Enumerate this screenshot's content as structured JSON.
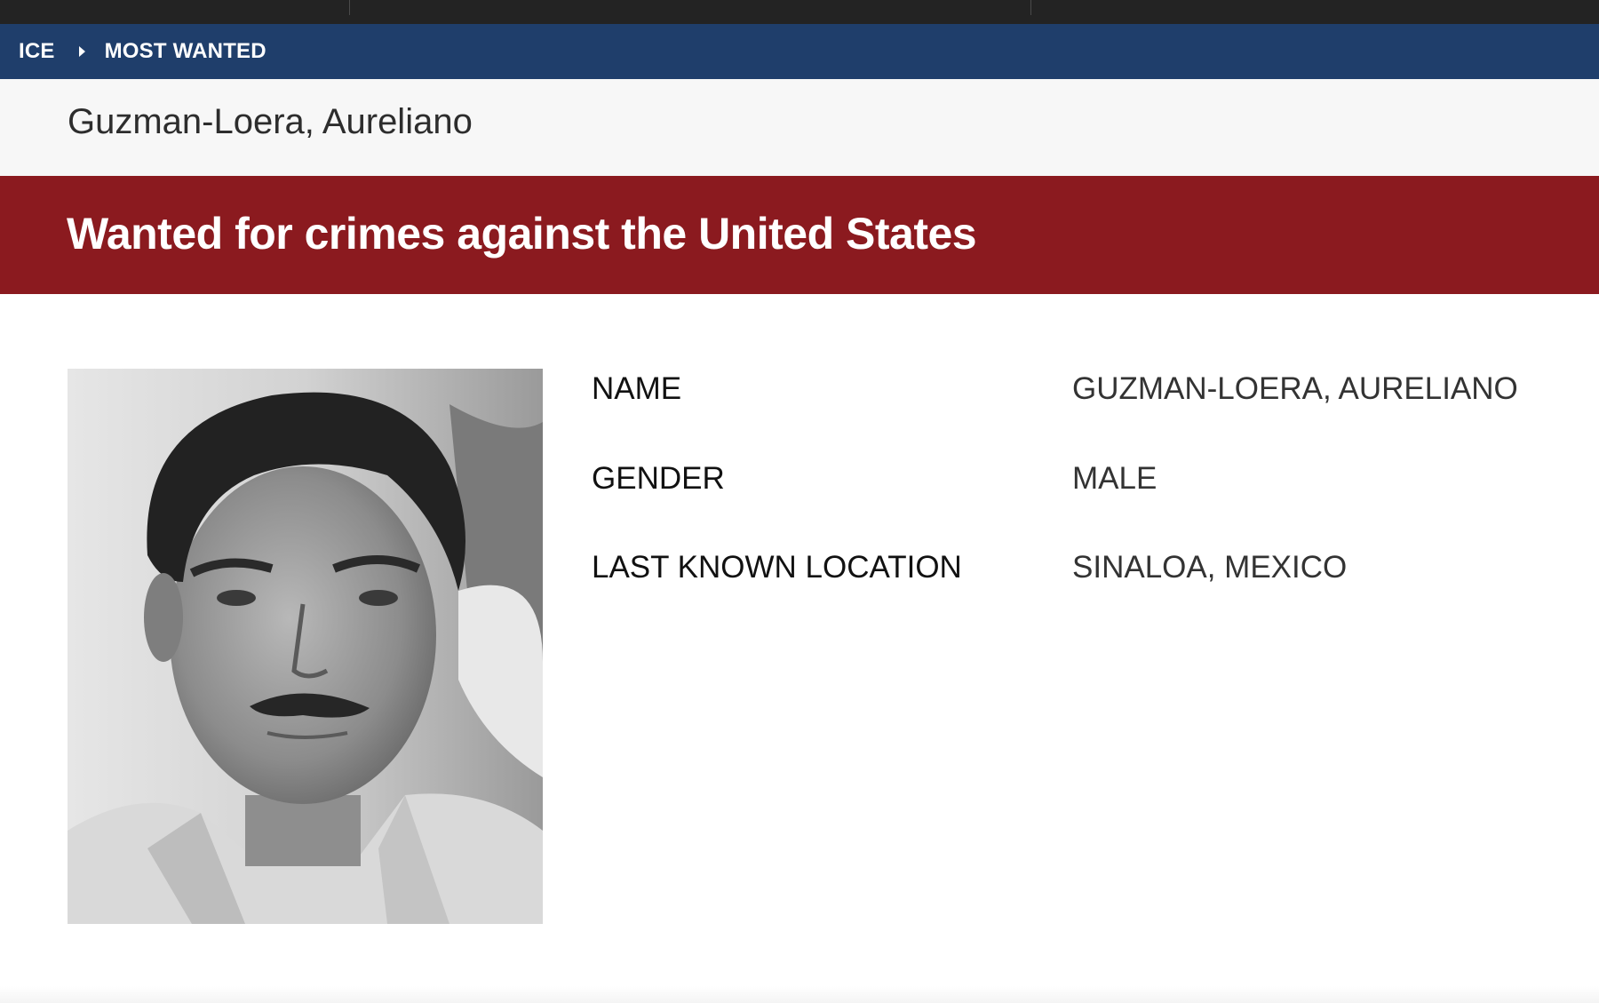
{
  "breadcrumb": {
    "items": [
      "ICE",
      "MOST WANTED"
    ]
  },
  "page_title": "Guzman-Loera, Aureliano",
  "banner": "Wanted for crimes against the United States",
  "details": [
    {
      "label": "NAME",
      "value": "GUZMAN-LOERA, AURELIANO"
    },
    {
      "label": "GENDER",
      "value": "MALE"
    },
    {
      "label": "LAST KNOWN LOCATION",
      "value": "SINALOA, MEXICO"
    }
  ],
  "colors": {
    "top_strip": "#232323",
    "breadcrumb_bar": "#1f3e6b",
    "title_bar": "#f7f7f7",
    "wanted_bar": "#8b1a1f"
  }
}
